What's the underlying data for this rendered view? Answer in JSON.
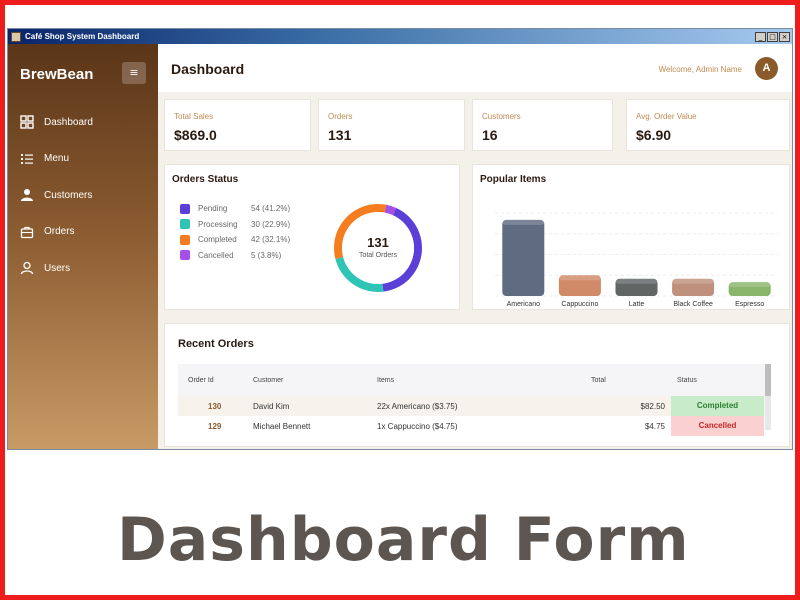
{
  "window": {
    "title": "Café Shop System Dashboard",
    "controls": [
      "_",
      "□",
      "×"
    ]
  },
  "sidebar": {
    "brand": "BrewBean",
    "toggle_icon": "hamburger-icon",
    "items": [
      {
        "label": "Dashboard",
        "icon": "grid-icon"
      },
      {
        "label": "Menu",
        "icon": "list-icon"
      },
      {
        "label": "Customers",
        "icon": "person-icon"
      },
      {
        "label": "Orders",
        "icon": "briefcase-icon"
      },
      {
        "label": "Users",
        "icon": "user-outline-icon"
      }
    ]
  },
  "header": {
    "title": "Dashboard",
    "welcome": "Welcome, Admin Name",
    "avatar_initial": "A"
  },
  "stats": [
    {
      "label": "Total Sales",
      "value": "$869.0"
    },
    {
      "label": "Orders",
      "value": "131"
    },
    {
      "label": "Customers",
      "value": "16"
    },
    {
      "label": "Avg. Order Value",
      "value": "$6.90"
    }
  ],
  "orders_status": {
    "title": "Orders Status",
    "total": "131",
    "total_label": "Total Orders",
    "items": [
      {
        "label": "Pending",
        "count": 54,
        "value_text": "54 (41.2%)",
        "color": "#5b3fd6"
      },
      {
        "label": "Processing",
        "count": 30,
        "value_text": "30 (22.9%)",
        "color": "#2ec4b6"
      },
      {
        "label": "Completed",
        "count": 42,
        "value_text": "42 (32.1%)",
        "color": "#f57c1f"
      },
      {
        "label": "Cancelled",
        "count": 5,
        "value_text": "5 (3.8%)",
        "color": "#a64fe8"
      }
    ]
  },
  "popular_items": {
    "title": "Popular Items",
    "chart_data": {
      "type": "bar",
      "categories": [
        "Americano",
        "Cappuccino",
        "Latte",
        "Black Coffee",
        "Espresso"
      ],
      "values": [
        22,
        6,
        5,
        5,
        4
      ],
      "colors": [
        "#5f6b80",
        "#d08a68",
        "#5f6664",
        "#bf907c",
        "#88b56a"
      ],
      "ylim": [
        0,
        24
      ],
      "grid": true
    }
  },
  "recent_orders": {
    "title": "Recent Orders",
    "columns": [
      "Order Id",
      "Customer",
      "Items",
      "Total",
      "Status"
    ],
    "rows": [
      {
        "id": "130",
        "customer": "David Kim",
        "items": "22x Americano ($3.75)",
        "total": "$82.50",
        "status": "Completed"
      },
      {
        "id": "129",
        "customer": "Michael Bennett",
        "items": "1x Cappuccino ($4.75)",
        "total": "$4.75",
        "status": "Cancelled"
      }
    ]
  },
  "caption": "Dashboard Form"
}
